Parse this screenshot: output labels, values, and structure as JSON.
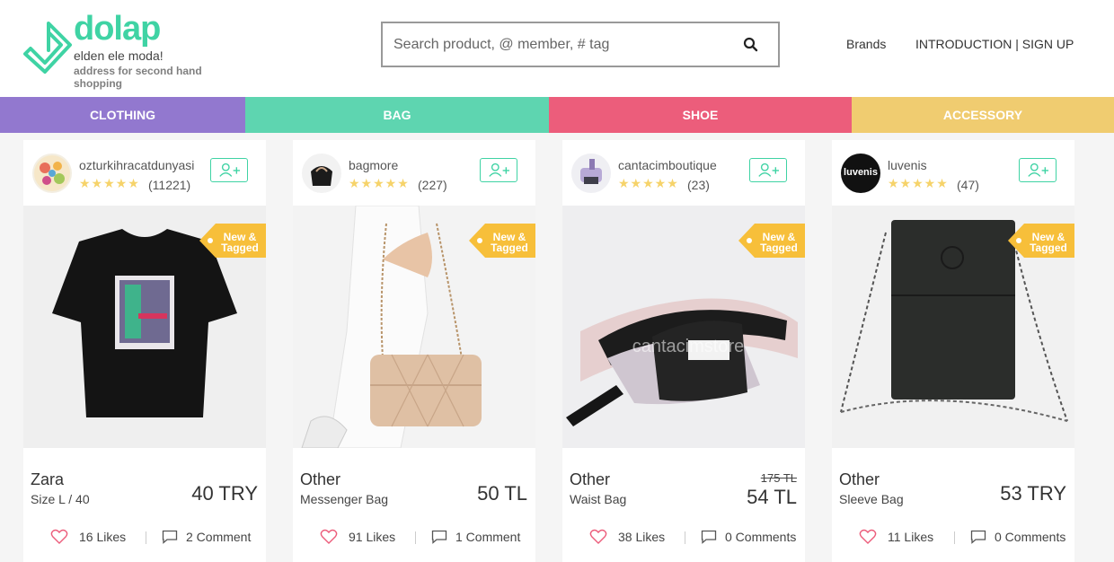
{
  "logo": {
    "name": "dolap",
    "tagline": "elden ele moda!",
    "subtitle": "address for second hand shopping"
  },
  "search": {
    "placeholder": "Search product, @ member, # tag",
    "icon": "search-icon"
  },
  "nav": {
    "brands": "Brands",
    "auth": "INTRODUCTION | SIGN UP"
  },
  "categories": [
    {
      "label": "CLOTHING",
      "color": "#9278cf"
    },
    {
      "label": "BAG",
      "color": "#5ed5b0"
    },
    {
      "label": "SHOE",
      "color": "#ec5d7b"
    },
    {
      "label": "ACCESSORY",
      "color": "#f0cc70"
    }
  ],
  "colors": {
    "brand": "#3fd3a4",
    "star": "#f6d36a",
    "ribbon": "#f7bf3a",
    "heart": "#ec5d7b"
  },
  "products": [
    {
      "seller": "ozturkihracatdunyasi",
      "stars": "★★★★★",
      "rating_count": "(11221)",
      "ribbon": "New & Tagged",
      "brand": "Zara",
      "subtitle": "Size L / 40",
      "old_price": "",
      "price": "40 TRY",
      "likes": "16 Likes",
      "comments": "2 Comment"
    },
    {
      "seller": "bagmore",
      "stars": "★★★★★",
      "rating_count": "(227)",
      "ribbon": "New & Tagged",
      "brand": "Other",
      "subtitle": "Messenger Bag",
      "old_price": "",
      "price": "50 TL",
      "likes": "91 Likes",
      "comments": "1 Comment"
    },
    {
      "seller": "cantacimboutique",
      "stars": "★★★★★",
      "rating_count": "(23)",
      "ribbon": "New & Tagged",
      "brand": "Other",
      "subtitle": "Waist Bag",
      "old_price": "175 TL",
      "price": "54 TL",
      "likes": "38 Likes",
      "comments": "0 Comments",
      "watermark": "cantacimstore"
    },
    {
      "seller": "luvenis",
      "avatar_text": "luvenis",
      "stars": "★★★★★",
      "rating_count": "(47)",
      "ribbon": "New & Tagged",
      "brand": "Other",
      "subtitle": "Sleeve Bag",
      "old_price": "",
      "price": "53 TRY",
      "likes": "11 Likes",
      "comments": "0 Comments"
    }
  ]
}
